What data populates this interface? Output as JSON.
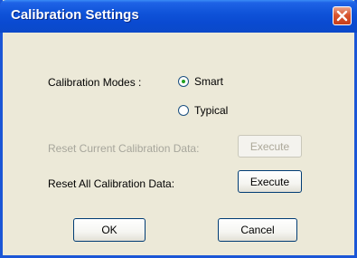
{
  "window": {
    "title": "Calibration Settings"
  },
  "modes": {
    "label": "Calibration Modes :",
    "options": [
      {
        "label": "Smart",
        "selected": true
      },
      {
        "label": "Typical",
        "selected": false
      }
    ]
  },
  "reset_current": {
    "label": "Reset Current Calibration Data:",
    "button": "Execute",
    "enabled": false
  },
  "reset_all": {
    "label": "Reset All Calibration Data:",
    "button": "Execute",
    "enabled": true
  },
  "footer": {
    "ok": "OK",
    "cancel": "Cancel"
  },
  "colors": {
    "titlebar": "#0a4ad1",
    "dialog_bg": "#ece9d8",
    "close": "#d9552e",
    "radio_dot": "#21a121"
  }
}
